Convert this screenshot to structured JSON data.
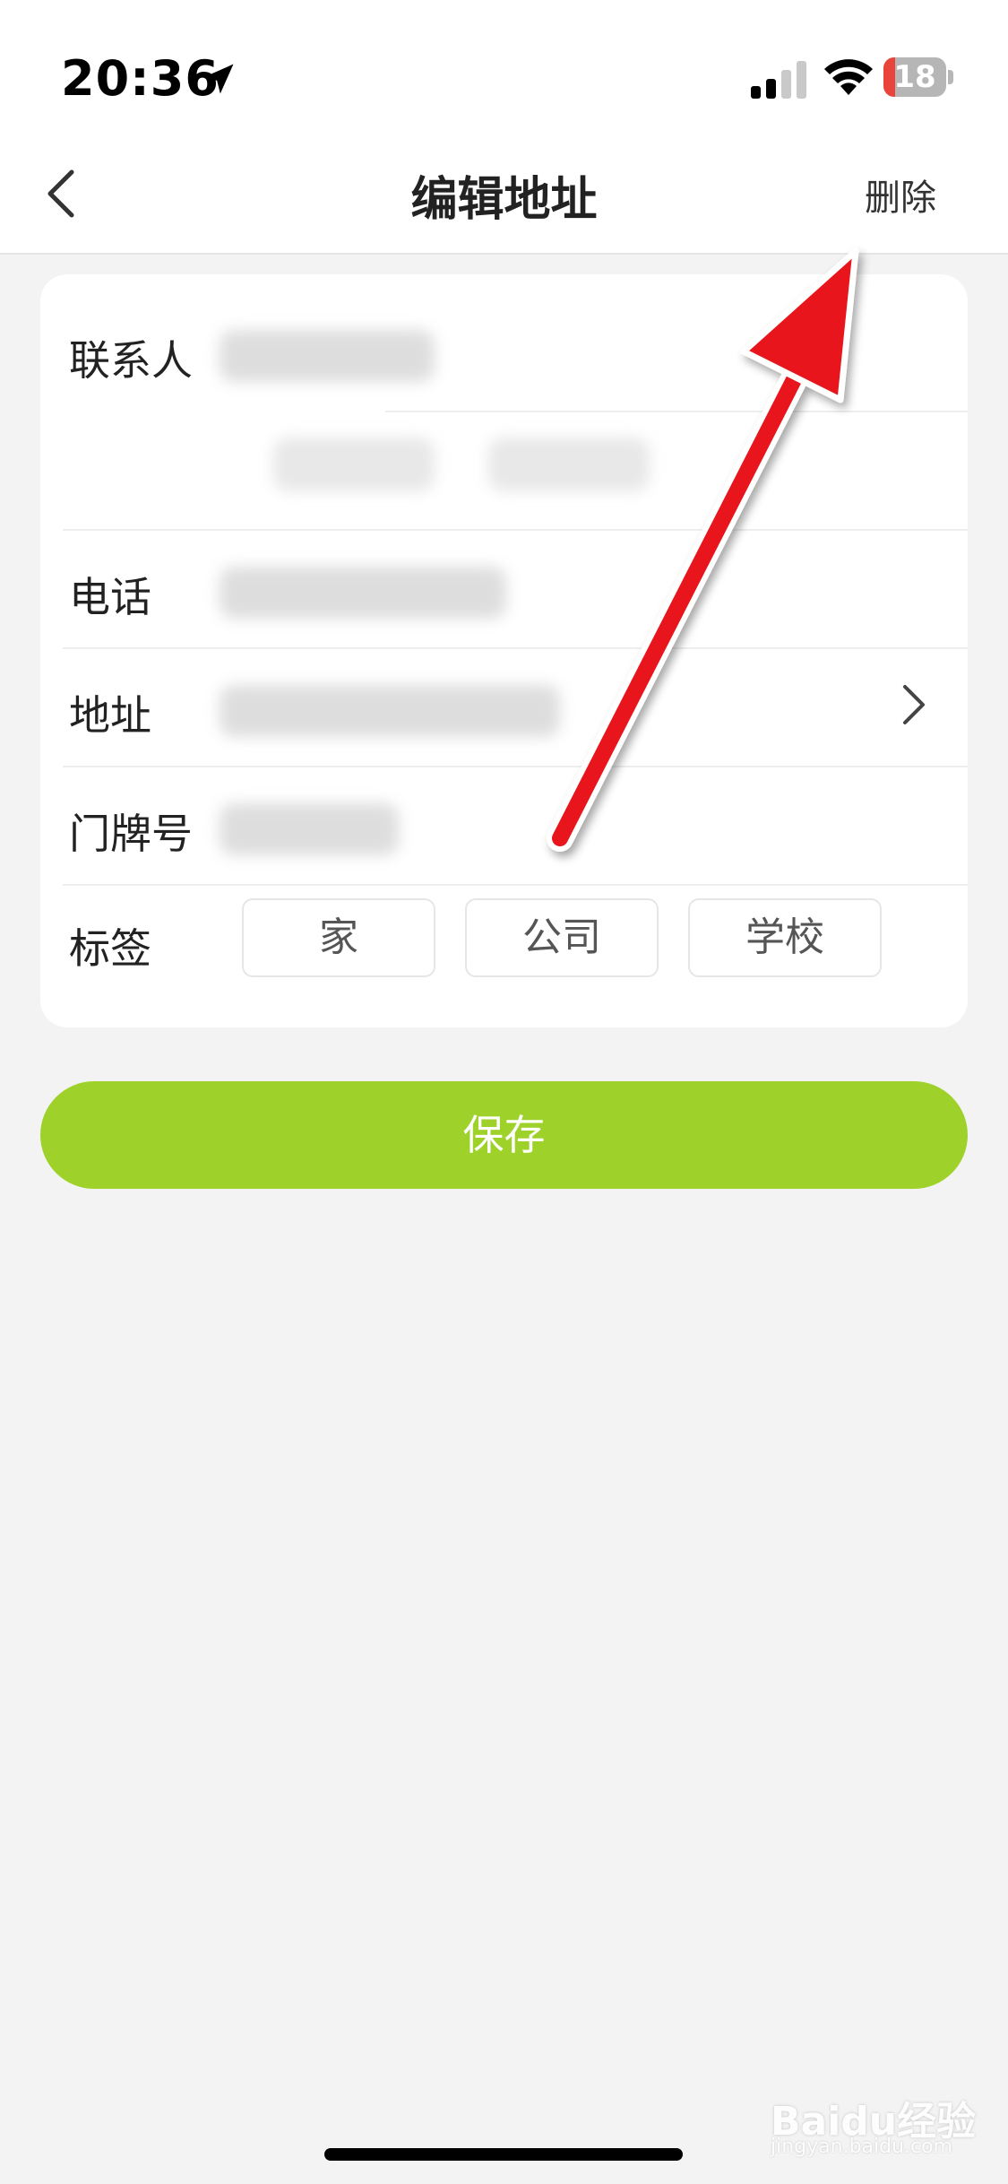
{
  "status_bar": {
    "time": "20:36",
    "battery_level": "18",
    "battery_fraction": 0.18,
    "icons": [
      "location-arrow-icon",
      "cellular-signal-icon",
      "wifi-icon",
      "battery-icon"
    ]
  },
  "nav": {
    "title": "编辑地址",
    "delete_label": "删除",
    "back_icon": "chevron-left-icon"
  },
  "form": {
    "contact_label": "联系人",
    "phone_label": "电话",
    "address_label": "地址",
    "door_label": "门牌号",
    "tag_label": "标签",
    "tags": [
      "家",
      "公司",
      "学校"
    ],
    "address_chevron_icon": "chevron-right-icon"
  },
  "save_label": "保存",
  "colors": {
    "accent": "#9ed22a",
    "annotation_arrow": "#e8131a",
    "background": "#f3f3f3"
  },
  "watermark": {
    "brand": "Baidu经验",
    "url": "jingyan.baidu.com"
  }
}
